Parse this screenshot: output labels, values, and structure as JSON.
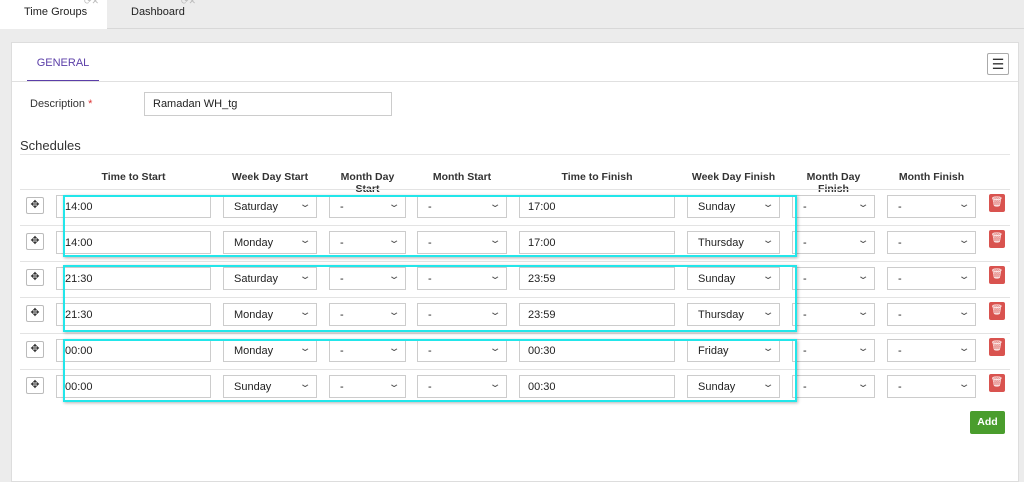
{
  "tabs": [
    {
      "label": "Time Groups",
      "active": true
    },
    {
      "label": "Dashboard",
      "active": false
    }
  ],
  "form": {
    "tab": "GENERAL",
    "description_label": "Description",
    "required_mark": "*",
    "description_value": "Ramadan WH_tg",
    "schedules_title": "Schedules",
    "add_label": "Add"
  },
  "columns": [
    "Time to Start",
    "Week Day Start",
    "Month Day Start",
    "Month Start",
    "Time to Finish",
    "Week Day Finish",
    "Month Day Finish",
    "Month Finish"
  ],
  "rows": [
    {
      "start": "14:00",
      "wd_start": "Saturday",
      "md_start": "-",
      "m_start": "-",
      "finish": "17:00",
      "wd_finish": "Sunday",
      "md_finish": "-",
      "m_finish": "-"
    },
    {
      "start": "14:00",
      "wd_start": "Monday",
      "md_start": "-",
      "m_start": "-",
      "finish": "17:00",
      "wd_finish": "Thursday",
      "md_finish": "-",
      "m_finish": "-"
    },
    {
      "start": "21:30",
      "wd_start": "Saturday",
      "md_start": "-",
      "m_start": "-",
      "finish": "23:59",
      "wd_finish": "Sunday",
      "md_finish": "-",
      "m_finish": "-"
    },
    {
      "start": "21:30",
      "wd_start": "Monday",
      "md_start": "-",
      "m_start": "-",
      "finish": "23:59",
      "wd_finish": "Thursday",
      "md_finish": "-",
      "m_finish": "-"
    },
    {
      "start": "00:00",
      "wd_start": "Monday",
      "md_start": "-",
      "m_start": "-",
      "finish": "00:30",
      "wd_finish": "Friday",
      "md_finish": "-",
      "m_finish": "-"
    },
    {
      "start": "00:00",
      "wd_start": "Sunday",
      "md_start": "-",
      "m_start": "-",
      "finish": "00:30",
      "wd_finish": "Sunday",
      "md_finish": "-",
      "m_finish": "-"
    }
  ],
  "colors": {
    "accent": "#5b3ea8",
    "highlight": "#22e6ea",
    "add": "#4a9d2d",
    "delete": "#d9534f"
  }
}
